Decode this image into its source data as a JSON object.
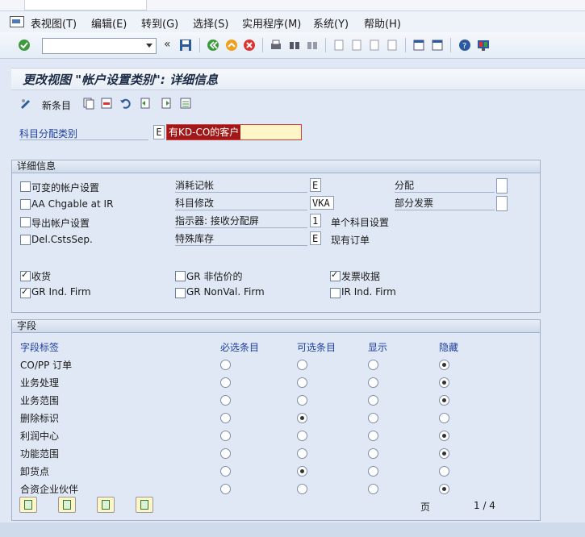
{
  "menu": [
    "表视图(T)",
    "编辑(E)",
    "转到(G)",
    "选择(S)",
    "实用程序(M)",
    "系统(Y)",
    "帮助(H)"
  ],
  "title": "更改视图 \"帐户设置类别\": 详细信息",
  "app_toolbar": {
    "new_entries": "新条目"
  },
  "account_category": {
    "label": "科目分配类别",
    "key": "E",
    "value": "有KD-CO的客户"
  },
  "details": {
    "header": "详细信息",
    "col1": [
      "可变的帐户设置",
      "AA Chgable at IR",
      "导出帐户设置",
      "Del.CstsSep."
    ],
    "col2": [
      {
        "label": "消耗记帐",
        "value": "E"
      },
      {
        "label": "科目修改",
        "value": "VKA"
      },
      {
        "label": "指示器: 接收分配屏",
        "value": "1",
        "desc": "单个科目设置"
      },
      {
        "label": "特殊库存",
        "value": "E",
        "desc": "现有订单"
      }
    ],
    "col3": [
      {
        "label": "分配",
        "value": ""
      },
      {
        "label": "部分发票",
        "value": ""
      }
    ],
    "checks_row1": [
      {
        "label": "收货",
        "checked": true
      },
      {
        "label": "GR 非估价的",
        "checked": false
      },
      {
        "label": "发票收据",
        "checked": true
      }
    ],
    "checks_row2": [
      {
        "label": "GR Ind. Firm",
        "checked": true
      },
      {
        "label": "GR NonVal. Firm",
        "checked": false
      },
      {
        "label": "IR Ind. Firm",
        "checked": false
      }
    ]
  },
  "fields": {
    "header": "字段",
    "columns": [
      "字段标签",
      "必选条目",
      "可选条目",
      "显示",
      "隐藏"
    ],
    "rows": [
      {
        "label": "CO/PP 订单",
        "selected": 3
      },
      {
        "label": "业务处理",
        "selected": 3
      },
      {
        "label": "业务范围",
        "selected": 3
      },
      {
        "label": "删除标识",
        "selected": 1
      },
      {
        "label": "利润中心",
        "selected": 3
      },
      {
        "label": "功能范围",
        "selected": 3
      },
      {
        "label": "卸货点",
        "selected": 1
      },
      {
        "label": "合资企业伙伴",
        "selected": 3
      }
    ],
    "page_label": "页",
    "page": "1 / 4"
  }
}
